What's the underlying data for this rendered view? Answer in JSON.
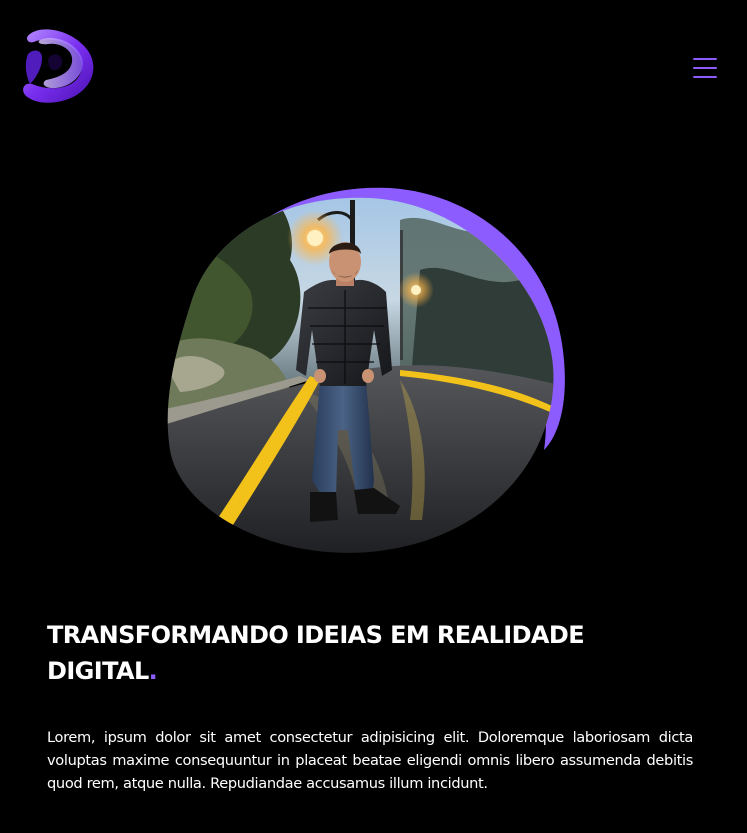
{
  "header": {
    "logo_icon": "brand-logo-d-swirl",
    "menu_icon": "hamburger-menu-icon"
  },
  "hero": {
    "image_subject": "man-standing-on-wet-road-at-night",
    "accent_color": "#8c5cff"
  },
  "headline": {
    "text": "TRANSFORMANDO IDEIAS EM REALIDADE DIGITAL",
    "accent_mark": "."
  },
  "description": {
    "text": "Lorem, ipsum dolor sit amet consectetur adipisicing elit. Doloremque laboriosam dicta voluptas maxime consequuntur in placeat beatae eligendi omnis libero assumenda debitis quod rem, atque nulla. Repudiandae accusamus illum incidunt."
  },
  "colors": {
    "background": "#000000",
    "accent": "#8c5cff",
    "text": "#ffffff",
    "road_line": "#f2c21b"
  }
}
